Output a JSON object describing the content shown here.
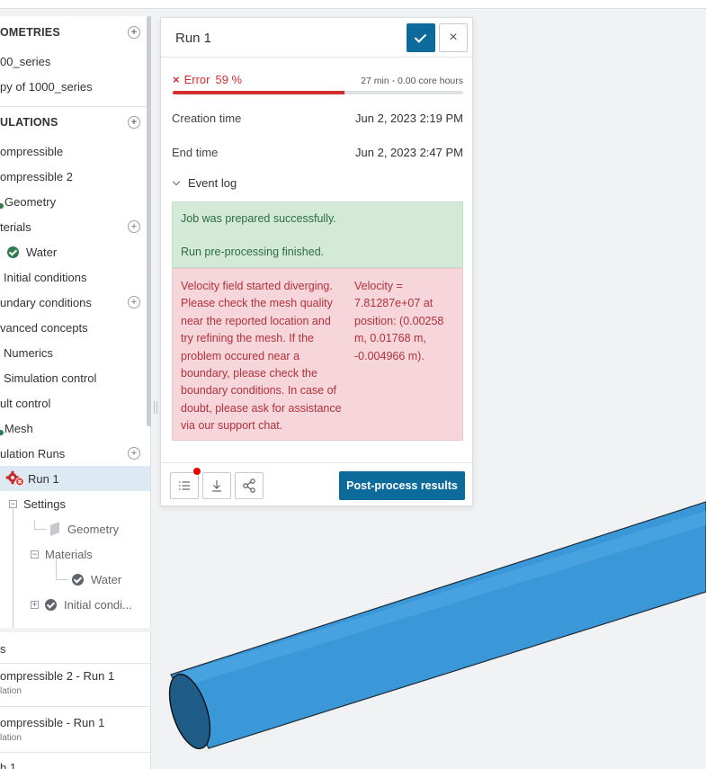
{
  "tree": {
    "items": [
      {
        "label": "OMETRIES",
        "kind": "section",
        "plus": true
      },
      {
        "label": "00_series"
      },
      {
        "label": "py of 1000_series"
      },
      {
        "label": "ULATIONS",
        "kind": "section",
        "plus": true
      },
      {
        "label": "ompressible"
      },
      {
        "label": "ompressible 2"
      },
      {
        "label": "Geometry"
      },
      {
        "label": "terials",
        "plus": true
      },
      {
        "label": "Water"
      },
      {
        "label": "Initial conditions"
      },
      {
        "label": "undary conditions",
        "plus": true
      },
      {
        "label": "vanced concepts"
      },
      {
        "label": "Numerics"
      },
      {
        "label": "Simulation control"
      },
      {
        "label": "ult control"
      },
      {
        "label": "Mesh"
      },
      {
        "label": "ulation Runs",
        "plus": true
      },
      {
        "label": "Run 1"
      },
      {
        "label": "Settings"
      },
      {
        "label": "Geometry"
      },
      {
        "label": "Materials"
      },
      {
        "label": "Water"
      },
      {
        "label": "Initial condi..."
      }
    ]
  },
  "jobs": {
    "header": "s",
    "items": [
      {
        "title": "ompressible 2 - Run 1",
        "sub": "lation"
      },
      {
        "title": "ompressible - Run 1",
        "sub": "lation"
      },
      {
        "title": "h 1",
        "sub": ""
      }
    ]
  },
  "dialog": {
    "title": "Run 1",
    "status_icon": "×",
    "status_label": "Error",
    "progress_text": "59 %",
    "progress": 59,
    "meta": "27 min - 0.00 core hours",
    "creation_label": "Creation time",
    "creation_value": "Jun 2, 2023 2:19 PM",
    "end_label": "End time",
    "end_value": "Jun 2, 2023 2:47 PM",
    "eventlog_label": "Event log",
    "log_success_1": "Job was prepared successfully.",
    "log_success_2": "Run pre-processing finished.",
    "log_error_main": "Velocity field started diverging. Please check the mesh quality near the reported location and try refining the mesh. If the problem occured near a boundary, please check the boundary conditions. In case of doubt, please ask for assistance via our support chat.",
    "log_error_detail": "Velocity = 7.81287e+07 at position: (0.00258 m, 0.01768 m, -0.004966 m).",
    "post_process_label": "Post-process results",
    "close_icon": "×"
  },
  "icons": {
    "confirm": "check-icon",
    "close": "close-icon",
    "list": "list-icon",
    "download": "download-icon",
    "share": "share-icon",
    "run_error": "gears-error-icon"
  },
  "colors": {
    "primary": "#0d6b9c",
    "error": "#d32f2f",
    "success_bg": "#d3ead8",
    "error_bg": "#f6d6da",
    "selected_row": "#dde9f3",
    "geometry": "#3a98d9"
  }
}
